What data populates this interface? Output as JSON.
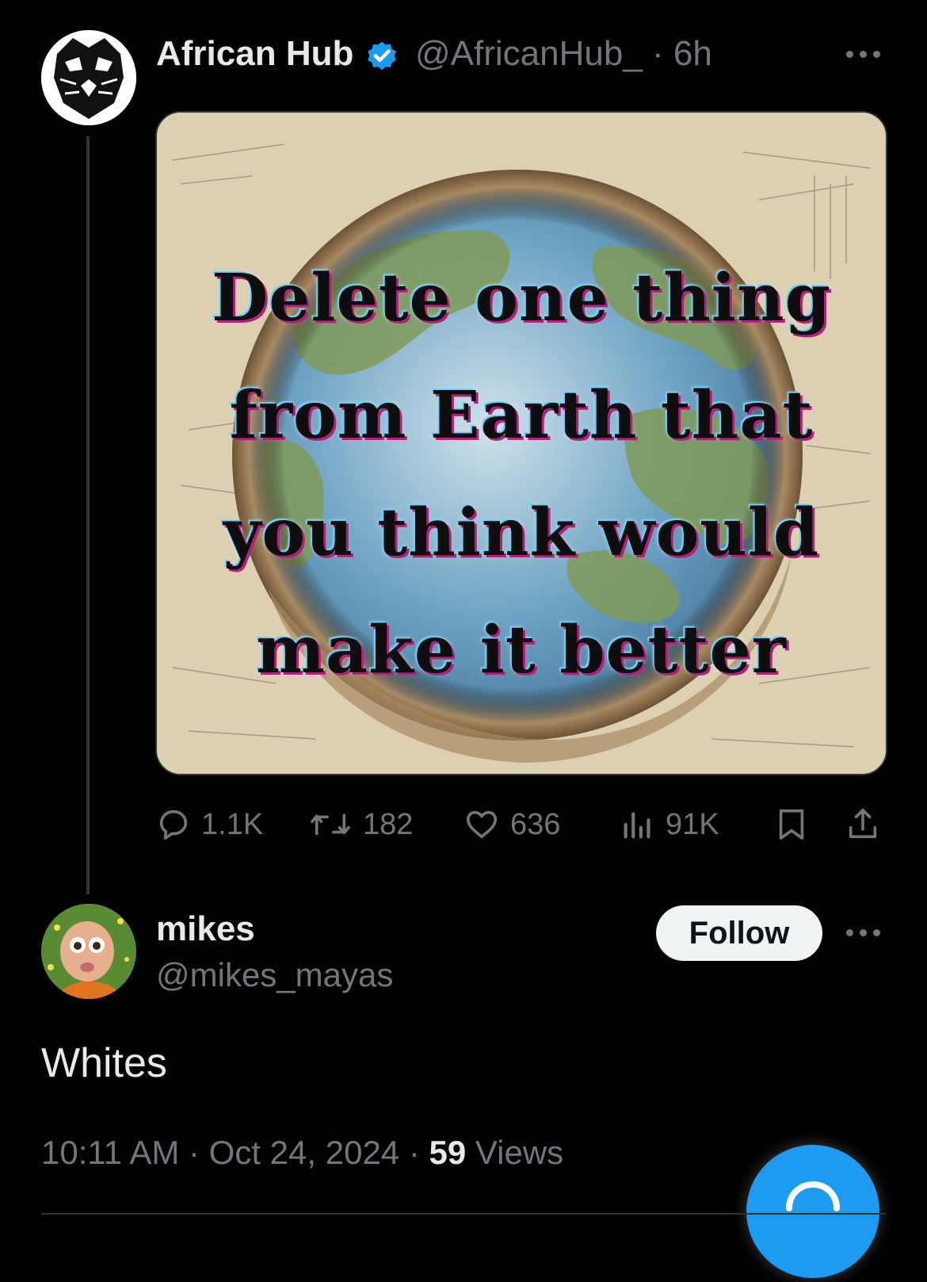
{
  "post": {
    "author_name": "African Hub",
    "verified_icon": "verified-badge-icon",
    "handle_time": "@AfricanHub_ · 6h",
    "media_text": [
      "Delete one thing",
      "from Earth that",
      "you think would",
      "make it better"
    ],
    "actions": {
      "replies": "1.1K",
      "reposts": "182",
      "likes": "636",
      "views": "91K"
    }
  },
  "reply": {
    "author_name": "mikes",
    "handle": "@mikes_mayas",
    "follow_label": "Follow",
    "text": "Whites",
    "time_date": "10:11 AM · Oct 24, 2024 · ",
    "views_count": "59",
    "views_label": " Views"
  },
  "colors": {
    "accent": "#1d9bf0",
    "muted": "#71767b",
    "text": "#e7e9ea",
    "background": "#000000"
  }
}
